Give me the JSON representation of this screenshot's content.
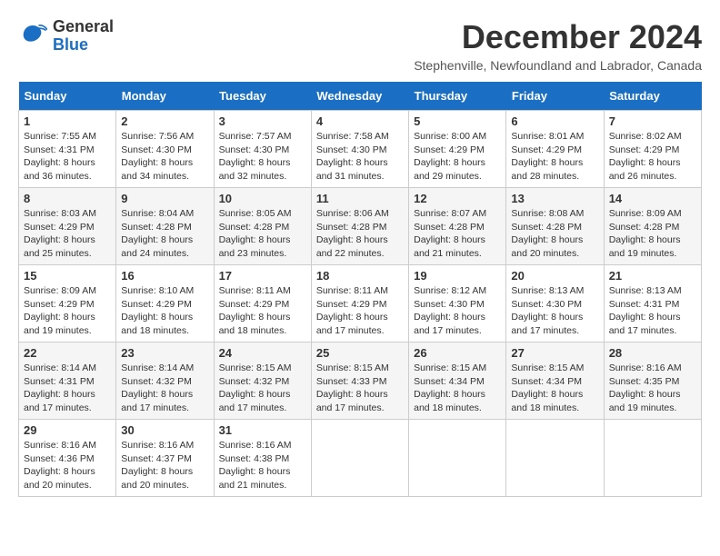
{
  "logo": {
    "general": "General",
    "blue": "Blue"
  },
  "title": "December 2024",
  "location": "Stephenville, Newfoundland and Labrador, Canada",
  "days_of_week": [
    "Sunday",
    "Monday",
    "Tuesday",
    "Wednesday",
    "Thursday",
    "Friday",
    "Saturday"
  ],
  "weeks": [
    [
      {
        "day": "1",
        "sunrise": "7:55 AM",
        "sunset": "4:31 PM",
        "daylight": "8 hours and 36 minutes."
      },
      {
        "day": "2",
        "sunrise": "7:56 AM",
        "sunset": "4:30 PM",
        "daylight": "8 hours and 34 minutes."
      },
      {
        "day": "3",
        "sunrise": "7:57 AM",
        "sunset": "4:30 PM",
        "daylight": "8 hours and 32 minutes."
      },
      {
        "day": "4",
        "sunrise": "7:58 AM",
        "sunset": "4:30 PM",
        "daylight": "8 hours and 31 minutes."
      },
      {
        "day": "5",
        "sunrise": "8:00 AM",
        "sunset": "4:29 PM",
        "daylight": "8 hours and 29 minutes."
      },
      {
        "day": "6",
        "sunrise": "8:01 AM",
        "sunset": "4:29 PM",
        "daylight": "8 hours and 28 minutes."
      },
      {
        "day": "7",
        "sunrise": "8:02 AM",
        "sunset": "4:29 PM",
        "daylight": "8 hours and 26 minutes."
      }
    ],
    [
      {
        "day": "8",
        "sunrise": "8:03 AM",
        "sunset": "4:29 PM",
        "daylight": "8 hours and 25 minutes."
      },
      {
        "day": "9",
        "sunrise": "8:04 AM",
        "sunset": "4:28 PM",
        "daylight": "8 hours and 24 minutes."
      },
      {
        "day": "10",
        "sunrise": "8:05 AM",
        "sunset": "4:28 PM",
        "daylight": "8 hours and 23 minutes."
      },
      {
        "day": "11",
        "sunrise": "8:06 AM",
        "sunset": "4:28 PM",
        "daylight": "8 hours and 22 minutes."
      },
      {
        "day": "12",
        "sunrise": "8:07 AM",
        "sunset": "4:28 PM",
        "daylight": "8 hours and 21 minutes."
      },
      {
        "day": "13",
        "sunrise": "8:08 AM",
        "sunset": "4:28 PM",
        "daylight": "8 hours and 20 minutes."
      },
      {
        "day": "14",
        "sunrise": "8:09 AM",
        "sunset": "4:28 PM",
        "daylight": "8 hours and 19 minutes."
      }
    ],
    [
      {
        "day": "15",
        "sunrise": "8:09 AM",
        "sunset": "4:29 PM",
        "daylight": "8 hours and 19 minutes."
      },
      {
        "day": "16",
        "sunrise": "8:10 AM",
        "sunset": "4:29 PM",
        "daylight": "8 hours and 18 minutes."
      },
      {
        "day": "17",
        "sunrise": "8:11 AM",
        "sunset": "4:29 PM",
        "daylight": "8 hours and 18 minutes."
      },
      {
        "day": "18",
        "sunrise": "8:11 AM",
        "sunset": "4:29 PM",
        "daylight": "8 hours and 17 minutes."
      },
      {
        "day": "19",
        "sunrise": "8:12 AM",
        "sunset": "4:30 PM",
        "daylight": "8 hours and 17 minutes."
      },
      {
        "day": "20",
        "sunrise": "8:13 AM",
        "sunset": "4:30 PM",
        "daylight": "8 hours and 17 minutes."
      },
      {
        "day": "21",
        "sunrise": "8:13 AM",
        "sunset": "4:31 PM",
        "daylight": "8 hours and 17 minutes."
      }
    ],
    [
      {
        "day": "22",
        "sunrise": "8:14 AM",
        "sunset": "4:31 PM",
        "daylight": "8 hours and 17 minutes."
      },
      {
        "day": "23",
        "sunrise": "8:14 AM",
        "sunset": "4:32 PM",
        "daylight": "8 hours and 17 minutes."
      },
      {
        "day": "24",
        "sunrise": "8:15 AM",
        "sunset": "4:32 PM",
        "daylight": "8 hours and 17 minutes."
      },
      {
        "day": "25",
        "sunrise": "8:15 AM",
        "sunset": "4:33 PM",
        "daylight": "8 hours and 17 minutes."
      },
      {
        "day": "26",
        "sunrise": "8:15 AM",
        "sunset": "4:34 PM",
        "daylight": "8 hours and 18 minutes."
      },
      {
        "day": "27",
        "sunrise": "8:15 AM",
        "sunset": "4:34 PM",
        "daylight": "8 hours and 18 minutes."
      },
      {
        "day": "28",
        "sunrise": "8:16 AM",
        "sunset": "4:35 PM",
        "daylight": "8 hours and 19 minutes."
      }
    ],
    [
      {
        "day": "29",
        "sunrise": "8:16 AM",
        "sunset": "4:36 PM",
        "daylight": "8 hours and 20 minutes."
      },
      {
        "day": "30",
        "sunrise": "8:16 AM",
        "sunset": "4:37 PM",
        "daylight": "8 hours and 20 minutes."
      },
      {
        "day": "31",
        "sunrise": "8:16 AM",
        "sunset": "4:38 PM",
        "daylight": "8 hours and 21 minutes."
      },
      null,
      null,
      null,
      null
    ]
  ]
}
